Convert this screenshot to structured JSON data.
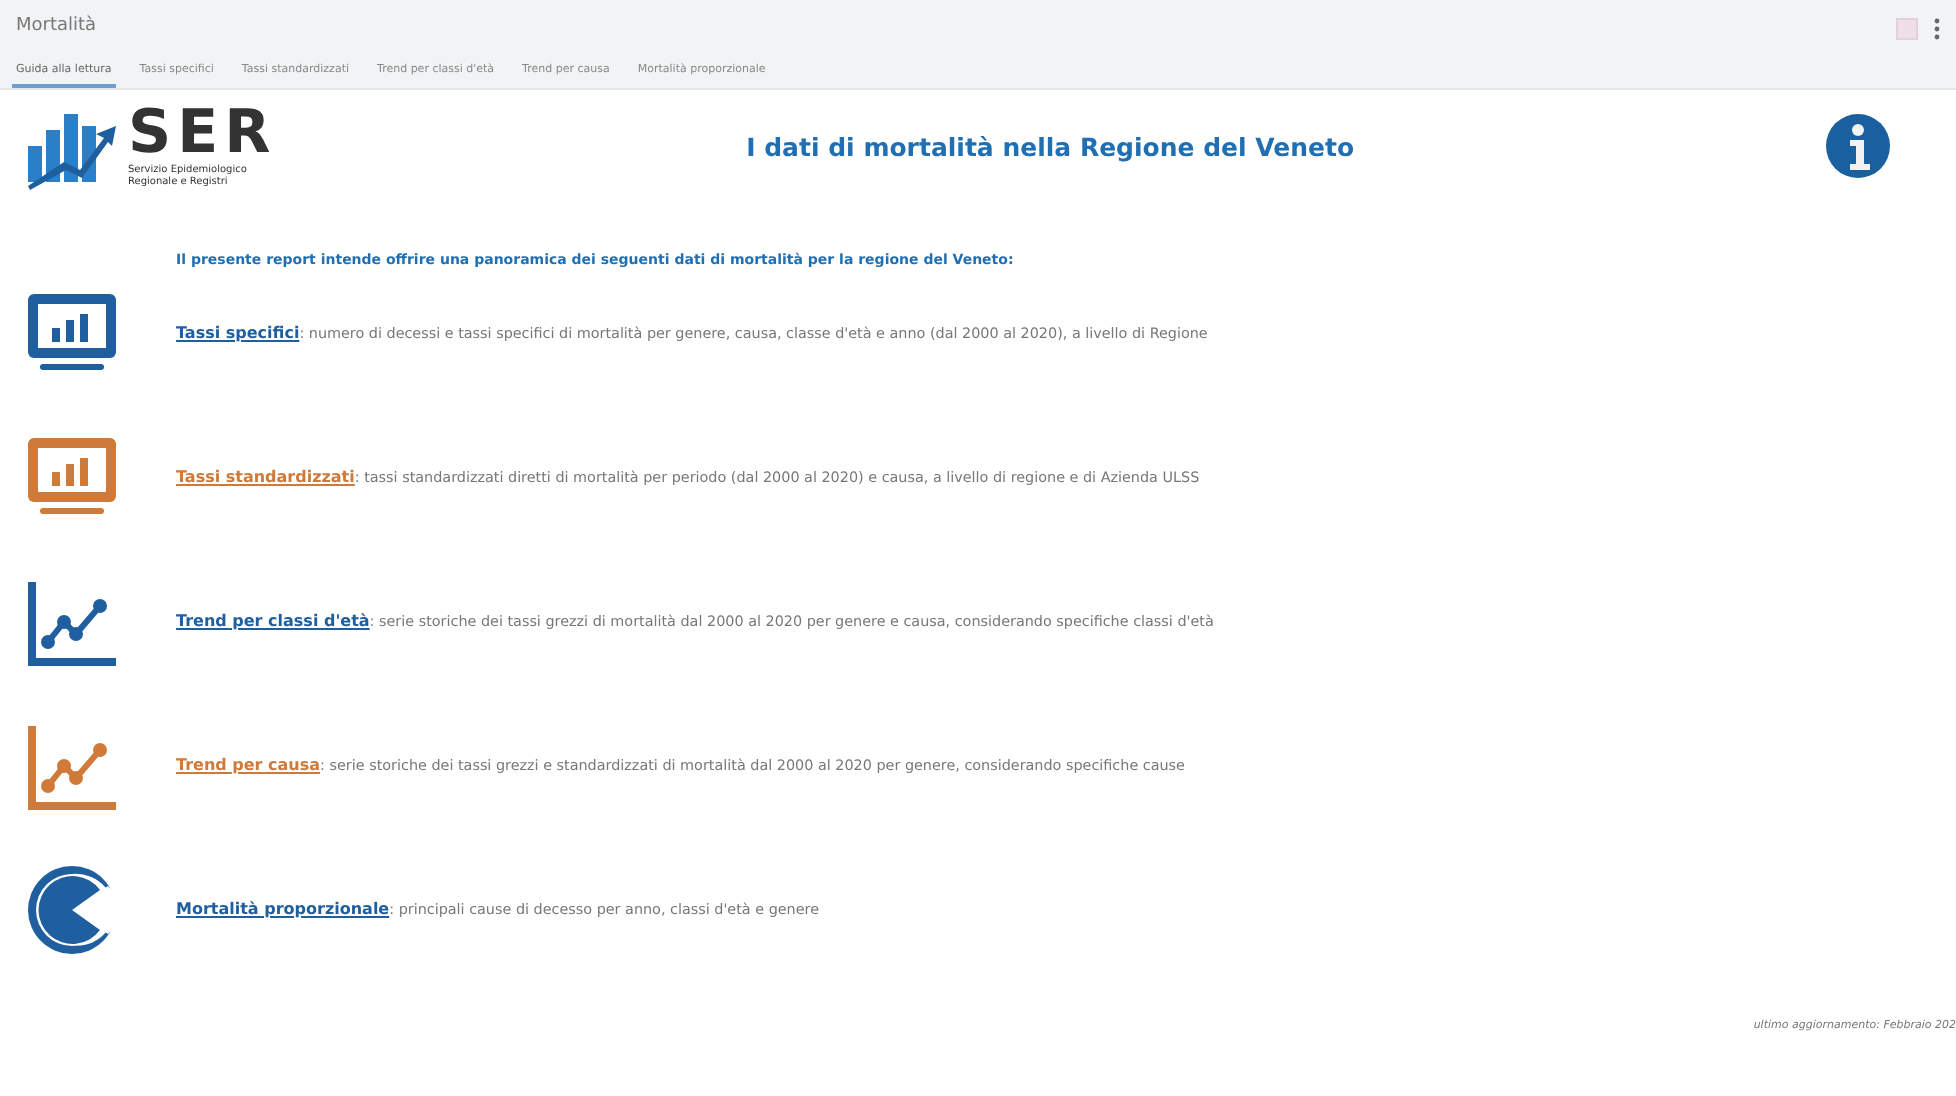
{
  "window": {
    "title": "Mortalità"
  },
  "tabs": [
    {
      "label": "Guida alla lettura",
      "selected": true
    },
    {
      "label": "Tassi specifici",
      "selected": false
    },
    {
      "label": "Tassi standardizzati",
      "selected": false
    },
    {
      "label": "Trend per classi d'età",
      "selected": false
    },
    {
      "label": "Trend per causa",
      "selected": false
    },
    {
      "label": "Mortalità proporzionale",
      "selected": false
    }
  ],
  "logo": {
    "acronym": "SER",
    "subtitle": [
      "Servizio Epidemiologico",
      "Regionale e Registri"
    ]
  },
  "heading": "I dati di mortalità nella Regione del Veneto",
  "intro": "Il presente report intende offrire una panoramica dei seguenti dati di mortalità per la regione del Veneto:",
  "items": [
    {
      "kind": "monitor",
      "color": "#1f5fa0",
      "link": "Tassi specifici",
      "description": ": numero di decessi e tassi specifici di mortalità per genere, causa, classe d'età e anno (dal 2000 al 2020), a livello di Regione"
    },
    {
      "kind": "monitor",
      "color": "#d07a3a",
      "link": "Tassi standardizzati",
      "description": ": tassi standardizzati diretti di mortalità per periodo (dal 2000 al 2020) e causa, a livello di regione e di Azienda ULSS"
    },
    {
      "kind": "trend",
      "color": "#1f5fa0",
      "link": "Trend per classi d'età",
      "description": ": serie storiche dei tassi grezzi di mortalità dal 2000 al 2020 per genere e causa, considerando specifiche classi d'età"
    },
    {
      "kind": "trend",
      "color": "#d07a3a",
      "link": "Trend per causa",
      "description": ": serie storiche dei tassi grezzi e standardizzati di mortalità dal 2000 al 2020 per genere, considerando specifiche cause"
    },
    {
      "kind": "pie",
      "color": "#1f5fa0",
      "link": "Mortalità proporzionale",
      "description": ": principali cause di decesso per anno, classi d'età e genere"
    }
  ],
  "footer": "ultimo aggiornamento: Febbraio 202"
}
